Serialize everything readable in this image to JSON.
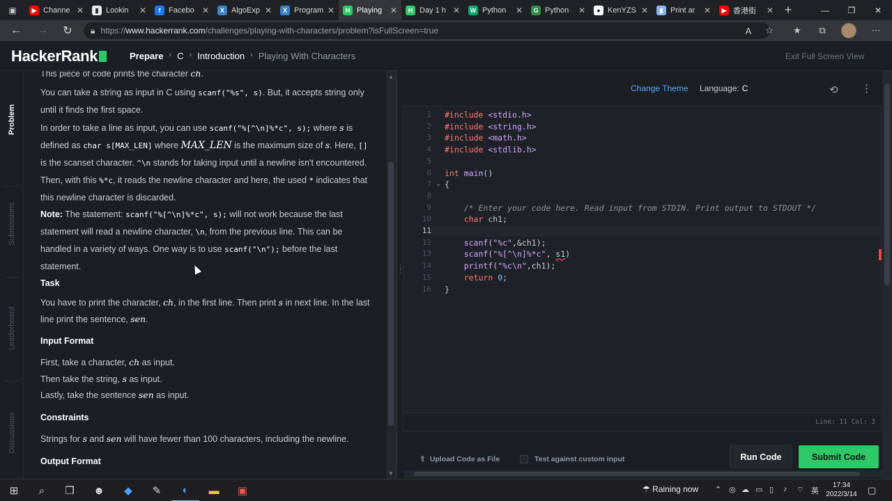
{
  "browser": {
    "tabs": [
      {
        "title": "Channe",
        "icon": "youtube-icon",
        "color": "#ff0000",
        "glyph": "▶"
      },
      {
        "title": "Lookin",
        "icon": "page-icon",
        "color": "#e8eaed",
        "glyph": "▮"
      },
      {
        "title": "Facebo",
        "icon": "facebook-icon",
        "color": "#1877f2",
        "glyph": "f"
      },
      {
        "title": "AlgoExp",
        "icon": "algoexpert-icon",
        "color": "#3b82c4",
        "glyph": "X"
      },
      {
        "title": "Program",
        "icon": "algoexpert-icon",
        "color": "#3b82c4",
        "glyph": "X"
      },
      {
        "title": "Playing",
        "icon": "hackerrank-icon",
        "color": "#2ec866",
        "glyph": "H"
      },
      {
        "title": "Day 1 h",
        "icon": "hackerrank-icon",
        "color": "#2ec866",
        "glyph": "H"
      },
      {
        "title": "Python",
        "icon": "w3-icon",
        "color": "#04aa6d",
        "glyph": "W"
      },
      {
        "title": "Python",
        "icon": "geeks-icon",
        "color": "#2f8d46",
        "glyph": "G"
      },
      {
        "title": "KenYZS",
        "icon": "github-icon",
        "color": "#ffffff",
        "glyph": "●"
      },
      {
        "title": "Print ar",
        "icon": "page-icon",
        "color": "#8ab4f8",
        "glyph": "▮"
      },
      {
        "title": "香港街",
        "icon": "youtube-icon",
        "color": "#ff0000",
        "glyph": "▶"
      }
    ],
    "active_tab": 5,
    "close_glyph": "✕",
    "new_tab": "+",
    "url_prefix": "https://",
    "url_host": "www.hackerrank.com",
    "url_path": "/challenges/playing-with-characters/problem?isFullScreen=true",
    "window_controls": [
      "—",
      "❐",
      "✕"
    ]
  },
  "header": {
    "logo": "HackerRank",
    "crumbs": [
      "Prepare",
      "C",
      "Introduction",
      "Playing With Characters"
    ],
    "exit_fullscreen": "Exit Full Screen View"
  },
  "side_tabs": [
    "Problem",
    "Submissions",
    "Leaderboard",
    "Discussions"
  ],
  "problem": {
    "p0_pre": "This piece of code prints the character ",
    "p0_var": "ch",
    "p1_pre": "You can take a string as input in C using ",
    "p1_code": "scanf(\"%s\", s)",
    "p1_post": ". But, it accepts string only until it finds the first space.",
    "p2_pre": "In order to take a line as input, you can use ",
    "p2_code": "scanf(\"%[^\\n]%*c\", s);",
    "p2_mid": " where ",
    "p2_s": "s",
    "p2_mid2": " is defined as ",
    "p2_code2": "char s[MAX_LEN]",
    "p2_mid3": " where ",
    "p2_max": "MAX_LEN",
    "p2_mid4": " is the maximum size of ",
    "p2_s2": "s",
    "p2_mid5": ". Here, ",
    "p2_code3": "[]",
    "p2_mid6": " is the scanset character. ",
    "p2_code4": "^\\n",
    "p2_mid7": " stands for taking input until a newline isn't encountered. Then, with this ",
    "p2_code5": "%*c",
    "p2_mid8": ", it reads the newline character and here, the used ",
    "p2_code6": "*",
    "p2_end": " indicates that this newline character is discarded.",
    "note_label": "Note:",
    "note_pre": " The statement: ",
    "note_code": "scanf(\"%[^\\n]%*c\", s);",
    "note_mid": " will not work because the last statement will read a newline character, ",
    "note_code2": "\\n",
    "note_mid2": ", from the previous line. This can be handled in a variety of ways. One way is to use ",
    "note_code3": "scanf(\"\\n\");",
    "note_end": " before the last statement.",
    "task_hd": "Task",
    "task_pre": "You have to print the character, ",
    "task_ch": "ch",
    "task_mid": ", in the first line. Then print ",
    "task_s": "s",
    "task_mid2": " in next line. In the last line print the sentence, ",
    "task_sen": "sen",
    "task_end": ".",
    "input_hd": "Input Format",
    "in1_pre": "First, take a character, ",
    "in1_var": "ch",
    "in1_end": " as input.",
    "in2_pre": "Then take the string, ",
    "in2_var": "s",
    "in2_end": " as input.",
    "in3_pre": "Lastly, take the sentence ",
    "in3_var": "sen",
    "in3_end": " as input.",
    "cons_hd": "Constraints",
    "cons_pre": "Strings for ",
    "cons_s": "s",
    "cons_and": " and ",
    "cons_sen": "sen",
    "cons_end": " will have fewer than 100 characters, including the newline.",
    "out_hd": "Output Format"
  },
  "editor": {
    "change_theme": "Change Theme",
    "language_label": "Language:",
    "language": "C",
    "line_numbers": [
      "1",
      "2",
      "3",
      "4",
      "5",
      "6",
      "7",
      "8",
      "9",
      "10",
      "11",
      "12",
      "13",
      "14",
      "15",
      "16"
    ],
    "current_line": "11",
    "status": "Line: 11 Col: 3",
    "upload": "Upload Code as File",
    "test_custom": "Test against custom input",
    "run": "Run Code",
    "submit": "Submit Code"
  },
  "taskbar": {
    "weather": "Raining now",
    "ime": "英",
    "time": "17:34",
    "date": "2022/3/14"
  }
}
